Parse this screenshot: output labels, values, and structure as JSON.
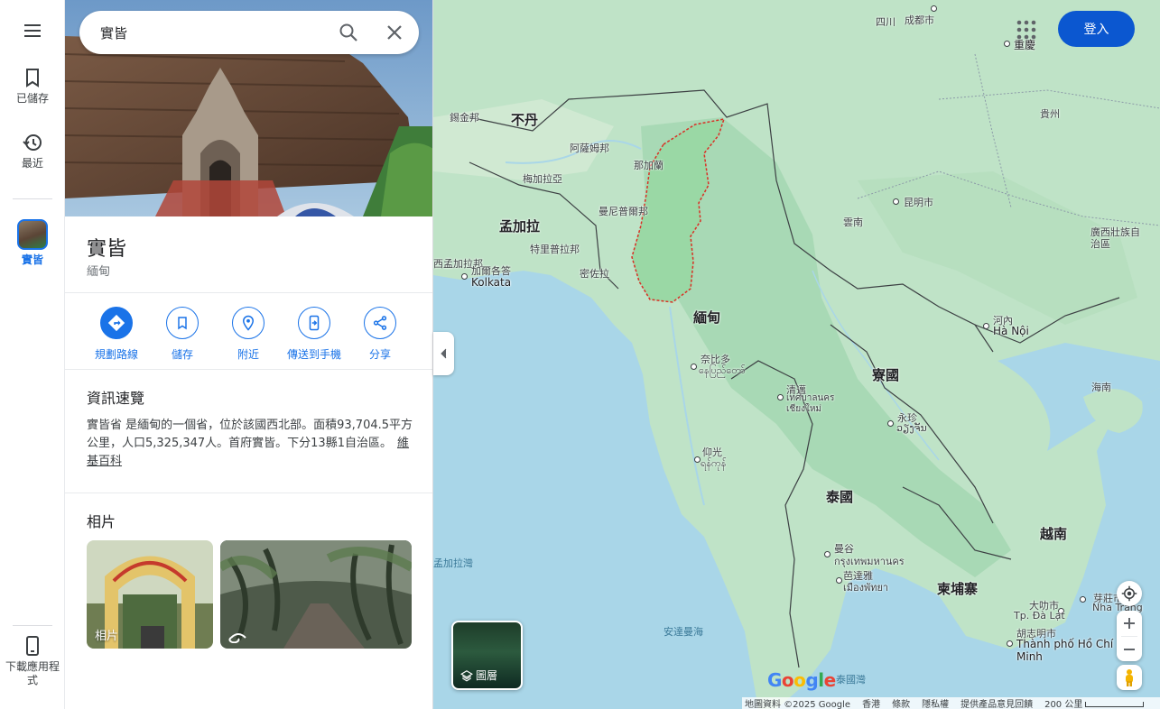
{
  "rail": {
    "saved_label": "已儲存",
    "recent_label": "最近",
    "place_label": "實皆",
    "download_label": "下載應用程式"
  },
  "search": {
    "value": "實皆"
  },
  "place": {
    "title": "實皆",
    "subtitle": "緬甸"
  },
  "actions": [
    {
      "label": "規劃路線",
      "icon": "directions-icon"
    },
    {
      "label": "儲存",
      "icon": "bookmark-icon"
    },
    {
      "label": "附近",
      "icon": "nearby-icon"
    },
    {
      "label": "傳送到手機",
      "icon": "send-to-phone-icon"
    },
    {
      "label": "分享",
      "icon": "share-icon"
    }
  ],
  "overview": {
    "title": "資訊速覽",
    "text": "實皆省 是緬甸的一個省，位於該國西北部。面積93,704.5平方公里，人口5,325,347人。首府實皆。下分13縣1自治區。",
    "link": "維基百科"
  },
  "photos": {
    "title": "相片",
    "caption": "相片"
  },
  "map": {
    "signin": "登入",
    "layers_label": "圖層",
    "labels": {
      "chengdu": "成都市",
      "sichuan": "四川",
      "chongqing": "重慶",
      "guizhou": "貴州",
      "bhutan": "不丹",
      "sikkim": "錫金邦",
      "assam": "阿薩姆邦",
      "nagaland": "那加蘭",
      "meghalaya": "梅加拉亞",
      "bangladesh": "孟加拉",
      "manipur": "曼尼普爾邦",
      "tripura": "特里普拉邦",
      "mizoram": "密佐拉",
      "westbengal": "西孟加拉邦",
      "kolkata_zh": "加爾各答",
      "kolkata_en": "Kolkata",
      "kunming": "昆明市",
      "yunnan": "雲南",
      "guangxi": "廣西壯族自治區",
      "myanmar": "緬甸",
      "hanoi_zh": "河內",
      "hanoi_en": "Hà Nội",
      "naypyidaw_zh": "奈比多",
      "naypyidaw_my": "နေပြည်တော်",
      "laos": "寮國",
      "chiangmai_zh": "清邁",
      "chiangmai_th": "เทศบาลนคร เชียงใหม่",
      "vientiane_zh": "永珍",
      "vientiane_lo": "ວຽງຈັນ",
      "hainan": "海南",
      "yangon_zh": "仰光",
      "yangon_my": "ရန်ကုန်",
      "thailand": "泰國",
      "vietnam": "越南",
      "bangkok_zh": "曼谷",
      "bangkok_th": "กรุงเทพมหานคร",
      "bengal_bay": "孟加拉灣",
      "pattaya_zh": "芭達雅",
      "pattaya_th": "เมืองพัทยา",
      "cambodia": "柬埔寨",
      "dalat_zh": "大叻市",
      "dalat_vi": "Tp. Đà Lạt",
      "nhatrang_zh": "芽莊市",
      "nhatrang_vi": "Nha Trang",
      "hcmc_zh": "胡志明市",
      "hcmc_vi": "Thành phố Hồ Chí Minh",
      "andaman": "安達曼海",
      "gulf_thailand": "泰國灣"
    },
    "footer": {
      "data": "地圖資料 ©2025 Google",
      "region": "香港",
      "terms": "條款",
      "privacy": "隱私權",
      "feedback": "提供產品意見回饋",
      "scale": "200 公里"
    },
    "colors": {
      "land": "#bfe3c7",
      "forest": "#98d2a8",
      "water": "#a9d6e8",
      "highlight": "#9ad8a5",
      "boundary_dash": "#d93025",
      "accent": "#1a73e8"
    }
  }
}
